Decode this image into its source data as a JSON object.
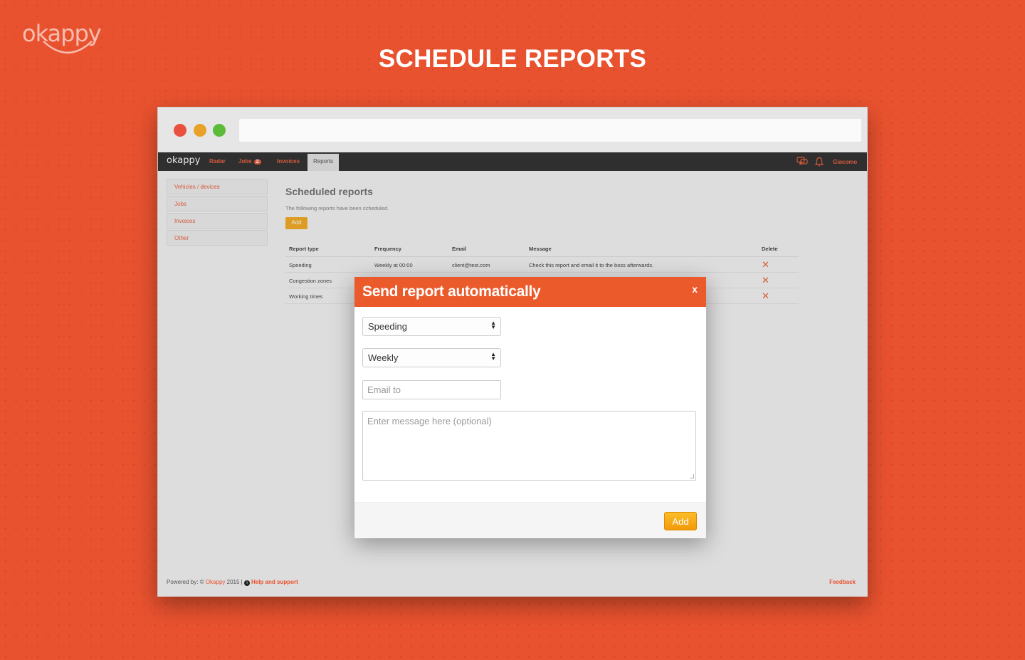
{
  "brand": {
    "logo_text": "okappy",
    "accent": "#e9522f"
  },
  "hero": {
    "title": "SCHEDULE REPORTS"
  },
  "app": {
    "nav": {
      "logo": "okappy",
      "items": [
        {
          "label": "Radar"
        },
        {
          "label": "Jobs",
          "badge": "2"
        },
        {
          "label": "Invoices"
        },
        {
          "label": "Reports",
          "active": true
        }
      ],
      "user": "Giacomo",
      "icons": [
        "chat-icon",
        "bell-icon"
      ]
    },
    "sidebar": {
      "items": [
        {
          "label": "Vehicles / devices"
        },
        {
          "label": "Jobs"
        },
        {
          "label": "Invoices"
        },
        {
          "label": "Other"
        }
      ]
    },
    "content": {
      "title": "Scheduled reports",
      "subtitle": "The following reports have been scheduled.",
      "add_label": "Add",
      "table": {
        "headers": [
          "Report type",
          "Frequency",
          "Email",
          "Message",
          "Delete"
        ],
        "rows": [
          {
            "type": "Speeding",
            "frequency": "Weekly at 00:00",
            "email": "client@test.com",
            "message": "Check this report and email it to the boss afterwards."
          },
          {
            "type": "Congestion zones",
            "frequency": "",
            "email": "",
            "message": ""
          },
          {
            "type": "Working times",
            "frequency": "",
            "email": "",
            "message": ""
          }
        ]
      }
    },
    "footer": {
      "powered_prefix": "Powered by: ©",
      "powered_link": "Okappy",
      "powered_suffix": "2015 |",
      "help": "Help and support",
      "feedback": "Feedback"
    }
  },
  "modal": {
    "title": "Send report automatically",
    "close_label": "x",
    "report_type": {
      "value": "Speeding"
    },
    "frequency": {
      "value": "Weekly"
    },
    "email": {
      "placeholder": "Email to"
    },
    "message": {
      "placeholder": "Enter message here (optional)"
    },
    "add_label": "Add"
  }
}
